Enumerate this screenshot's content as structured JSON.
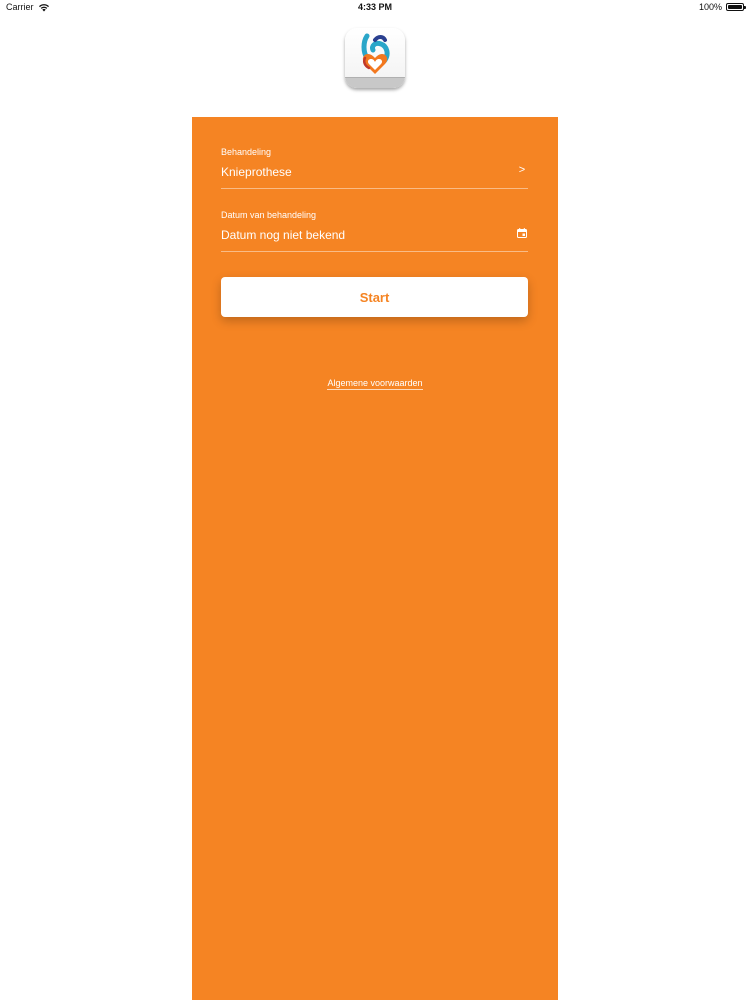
{
  "status_bar": {
    "carrier": "Carrier",
    "time": "4:33 PM",
    "battery": "100%"
  },
  "form": {
    "treatment": {
      "label": "Behandeling",
      "value": "Knieprothese",
      "action_glyph": ">"
    },
    "date": {
      "label": "Datum van behandeling",
      "value": "Datum nog niet bekend",
      "icon": "calendar-icon"
    },
    "start_label": "Start",
    "terms_link": "Algemene voorwaarden"
  },
  "colors": {
    "accent": "#f58423",
    "button_bg": "#ffffff",
    "text_on_accent": "#ffffff"
  },
  "icons": {
    "wifi": "wifi-icon",
    "battery": "battery-icon",
    "logo": "app-logo-icon"
  }
}
